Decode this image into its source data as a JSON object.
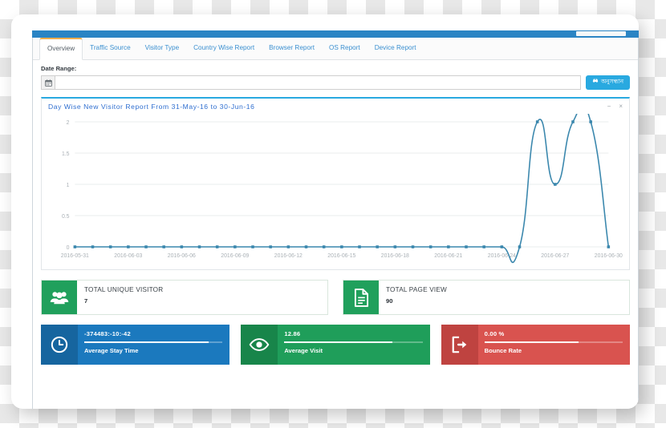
{
  "window": {
    "topbar_color": "#2a84c4"
  },
  "tabs": [
    {
      "label": "Overview",
      "active": true
    },
    {
      "label": "Traffic Source",
      "active": false
    },
    {
      "label": "Visitor Type",
      "active": false
    },
    {
      "label": "Country Wise Report",
      "active": false
    },
    {
      "label": "Browser Report",
      "active": false
    },
    {
      "label": "OS Report",
      "active": false
    },
    {
      "label": "Device Report",
      "active": false
    }
  ],
  "date_range": {
    "label": "Date Range:",
    "value": "",
    "placeholder": "",
    "calendar_icon": "calendar-icon",
    "search_button": {
      "label": "অনুসন্ধান",
      "icon": "search-binoculars-icon",
      "color": "#29a9e0"
    }
  },
  "panel": {
    "title": "Day Wise New Visitor Report From 31-May-16 to 30-Jun-16",
    "minimize_label": "−",
    "close_label": "×",
    "accent_color": "#29a9e0"
  },
  "chart_data": {
    "type": "line",
    "title": "Day Wise New Visitor Report From 31-May-16 to 30-Jun-16",
    "xlabel": "",
    "ylabel": "",
    "ylim": [
      0,
      2
    ],
    "yticks": [
      0,
      0.5,
      1,
      1.5,
      2
    ],
    "ytick_labels": [
      "0",
      "0.5",
      "1",
      "1.5",
      "2"
    ],
    "grid": true,
    "legend": "none",
    "line_color": "#3a87ad",
    "marker": "square",
    "x": [
      "2016-05-31",
      "2016-06-01",
      "2016-06-02",
      "2016-06-03",
      "2016-06-04",
      "2016-06-05",
      "2016-06-06",
      "2016-06-07",
      "2016-06-08",
      "2016-06-09",
      "2016-06-10",
      "2016-06-11",
      "2016-06-12",
      "2016-06-13",
      "2016-06-14",
      "2016-06-15",
      "2016-06-16",
      "2016-06-17",
      "2016-06-18",
      "2016-06-19",
      "2016-06-20",
      "2016-06-21",
      "2016-06-22",
      "2016-06-23",
      "2016-06-24",
      "2016-06-25",
      "2016-06-26",
      "2016-06-27",
      "2016-06-28",
      "2016-06-29",
      "2016-06-30"
    ],
    "xtick_labels": [
      "2016-05-31",
      "2016-06-03",
      "2016-06-06",
      "2016-06-09",
      "2016-06-12",
      "2016-06-15",
      "2016-06-18",
      "2016-06-21",
      "2016-06-24",
      "2016-06-27",
      "2016-06-30"
    ],
    "values": [
      0,
      0,
      0,
      0,
      0,
      0,
      0,
      0,
      0,
      0,
      0,
      0,
      0,
      0,
      0,
      0,
      0,
      0,
      0,
      0,
      0,
      0,
      0,
      0,
      0,
      0,
      2,
      1,
      2,
      2,
      0
    ]
  },
  "big_cards": [
    {
      "title": "TOTAL UNIQUE VISITOR",
      "value": "7",
      "icon": "users-icon",
      "color": "#20a05c"
    },
    {
      "title": "TOTAL PAGE VIEW",
      "value": "90",
      "icon": "document-icon",
      "color": "#20a05c"
    }
  ],
  "tiles": [
    {
      "value": "-374483:-10:-42",
      "label": "Average Stay Time",
      "icon": "clock-icon",
      "color": "#1b79be",
      "progress": 90
    },
    {
      "value": "12.86",
      "label": "Average Visit",
      "icon": "eye-icon",
      "color": "#1f9e5a",
      "progress": 78
    },
    {
      "value": "0.00 %",
      "label": "Bounce Rate",
      "icon": "exit-icon",
      "color": "#d9534f",
      "progress": 68
    }
  ]
}
